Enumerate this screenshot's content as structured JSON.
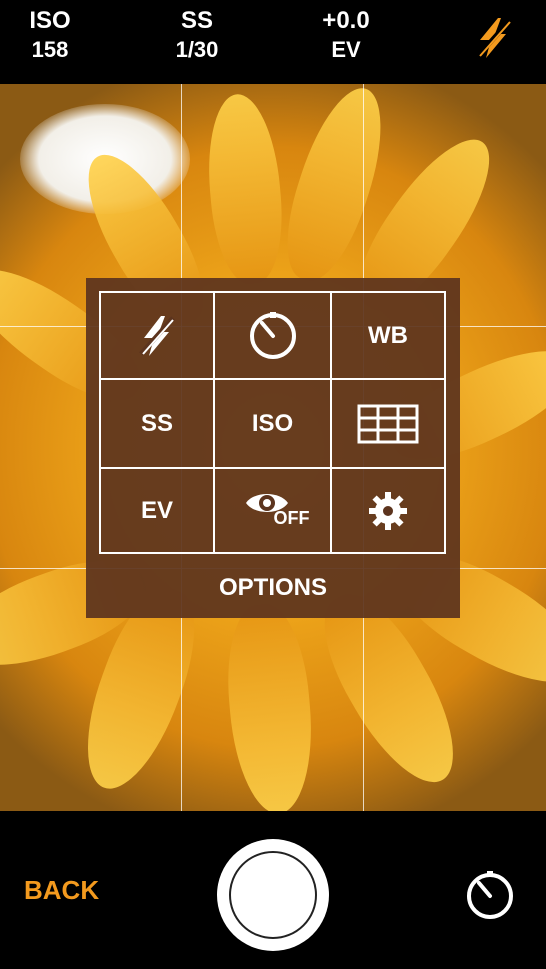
{
  "topbar": {
    "iso": {
      "label": "ISO",
      "value": "158"
    },
    "ss": {
      "label": "SS",
      "value": "1/30"
    },
    "ev": {
      "label": "+0.0",
      "value": "EV"
    },
    "flash_icon": "flash-auto-icon",
    "accent": "#f39a1e"
  },
  "options_menu": {
    "title": "OPTIONS",
    "cells": [
      {
        "icon": "flash-off-icon",
        "label": ""
      },
      {
        "icon": "timer-icon",
        "label": ""
      },
      {
        "icon": "",
        "label": "WB"
      },
      {
        "icon": "",
        "label": "SS"
      },
      {
        "icon": "",
        "label": "ISO"
      },
      {
        "icon": "grid-icon",
        "label": ""
      },
      {
        "icon": "",
        "label": "EV"
      },
      {
        "icon": "eye-icon",
        "label": "OFF"
      },
      {
        "icon": "gear-icon",
        "label": ""
      }
    ]
  },
  "bottombar": {
    "back_label": "BACK",
    "shutter_icon": "shutter-button",
    "timer_icon": "timer-icon"
  }
}
